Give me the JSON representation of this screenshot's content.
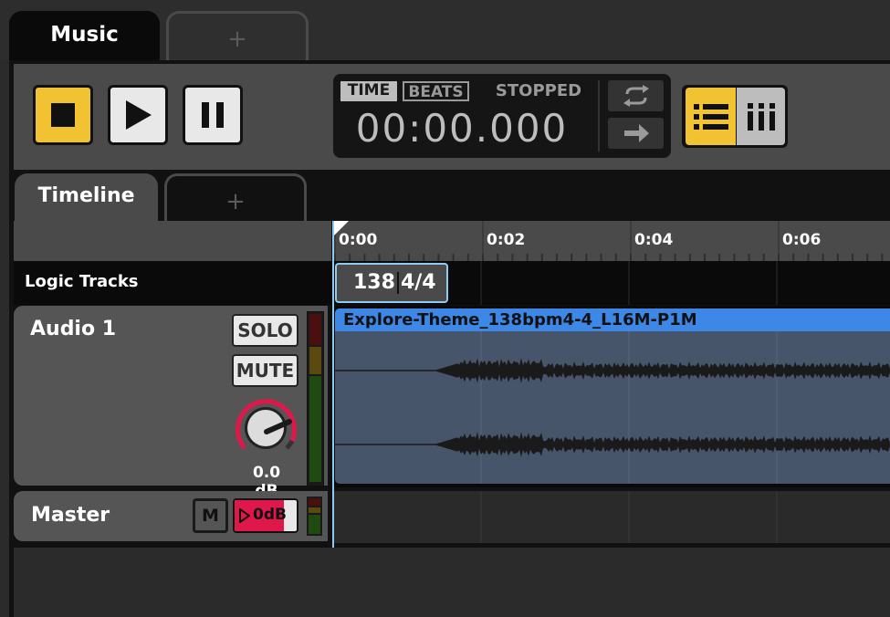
{
  "top_tabs": {
    "active": "Music",
    "add": "+"
  },
  "transport": {
    "stop": "stop-icon",
    "play": "play-icon",
    "pause": "pause-icon",
    "display": {
      "mode_time": "TIME",
      "mode_beats": "BEATS",
      "status": "STOPPED",
      "clock": "00:00.000"
    },
    "loop": "loop-icon",
    "follow": "arrow-right-icon",
    "list_view": "list-icon",
    "grid_view": "mixer-icon"
  },
  "sub_tabs": {
    "active": "Timeline",
    "add": "+"
  },
  "ruler": {
    "labels": [
      "0:00",
      "0:02",
      "0:04",
      "0:06"
    ]
  },
  "logic_tracks": {
    "label": "Logic Tracks",
    "tempo": "138",
    "signature": "4/4"
  },
  "tracks": [
    {
      "name": "Audio 1",
      "solo": "SOLO",
      "mute": "MUTE",
      "volume": "0.0 dB"
    },
    {
      "name": "Master",
      "mute": "M",
      "volume": "0dB"
    }
  ],
  "clip": {
    "name": "Explore-Theme_138bpm4-4_L16M-P1M"
  },
  "colors": {
    "accent": "#f1c232",
    "clip": "#3d87e6",
    "record": "#e0174b"
  }
}
